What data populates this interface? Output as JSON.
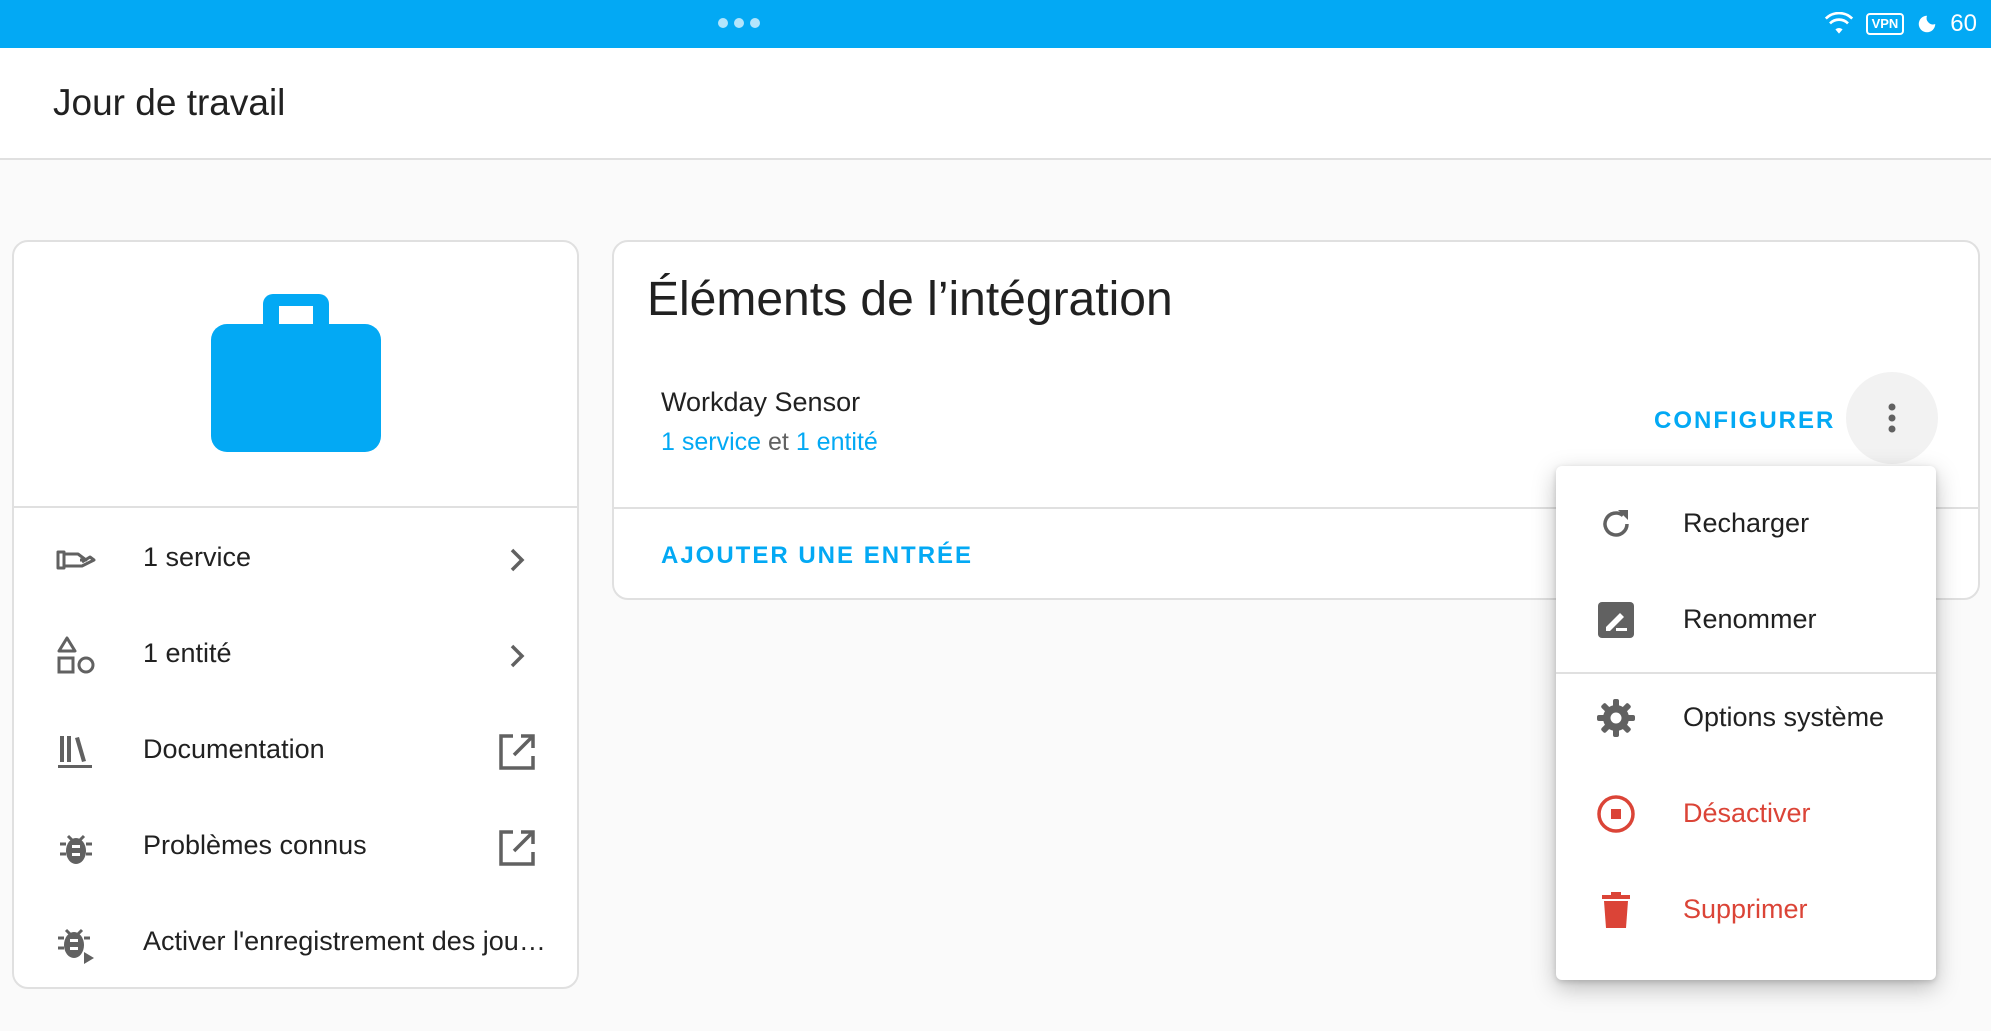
{
  "status_bar": {
    "vpn": "VPN",
    "battery": "60"
  },
  "header": {
    "title": "Jour de travail"
  },
  "left_card": {
    "links": [
      {
        "label": "1 service",
        "icon": "service-hand-icon",
        "trailing": "chevron-right-icon"
      },
      {
        "label": "1 entité",
        "icon": "shapes-icon",
        "trailing": "chevron-right-icon"
      },
      {
        "label": "Documentation",
        "icon": "library-books-icon",
        "trailing": "open-in-new-icon"
      },
      {
        "label": "Problèmes connus",
        "icon": "bug-icon",
        "trailing": "open-in-new-icon"
      },
      {
        "label": "Activer l'enregistrement des journaux de débogage",
        "icon": "bug-play-icon"
      }
    ]
  },
  "right_card": {
    "title": "Éléments de l’intégration",
    "entry": {
      "name": "Workday Sensor",
      "services_link": "1 service",
      "conjunction": "et",
      "entities_link": "1 entité"
    },
    "configure_label": "CONFIGURER",
    "add_entry_label": "AJOUTER UNE ENTRÉE"
  },
  "menu": {
    "items": [
      {
        "label": "Recharger",
        "icon": "reload-icon"
      },
      {
        "label": "Renommer",
        "icon": "rename-icon"
      },
      {
        "label": "Options système",
        "icon": "gear-icon"
      },
      {
        "label": "Désactiver",
        "icon": "stop-circle-icon",
        "danger": true
      },
      {
        "label": "Supprimer",
        "icon": "trash-icon",
        "danger": true
      }
    ]
  },
  "colors": {
    "accent": "#03a9f4",
    "danger": "#db4437",
    "icon_grey": "#616161"
  }
}
